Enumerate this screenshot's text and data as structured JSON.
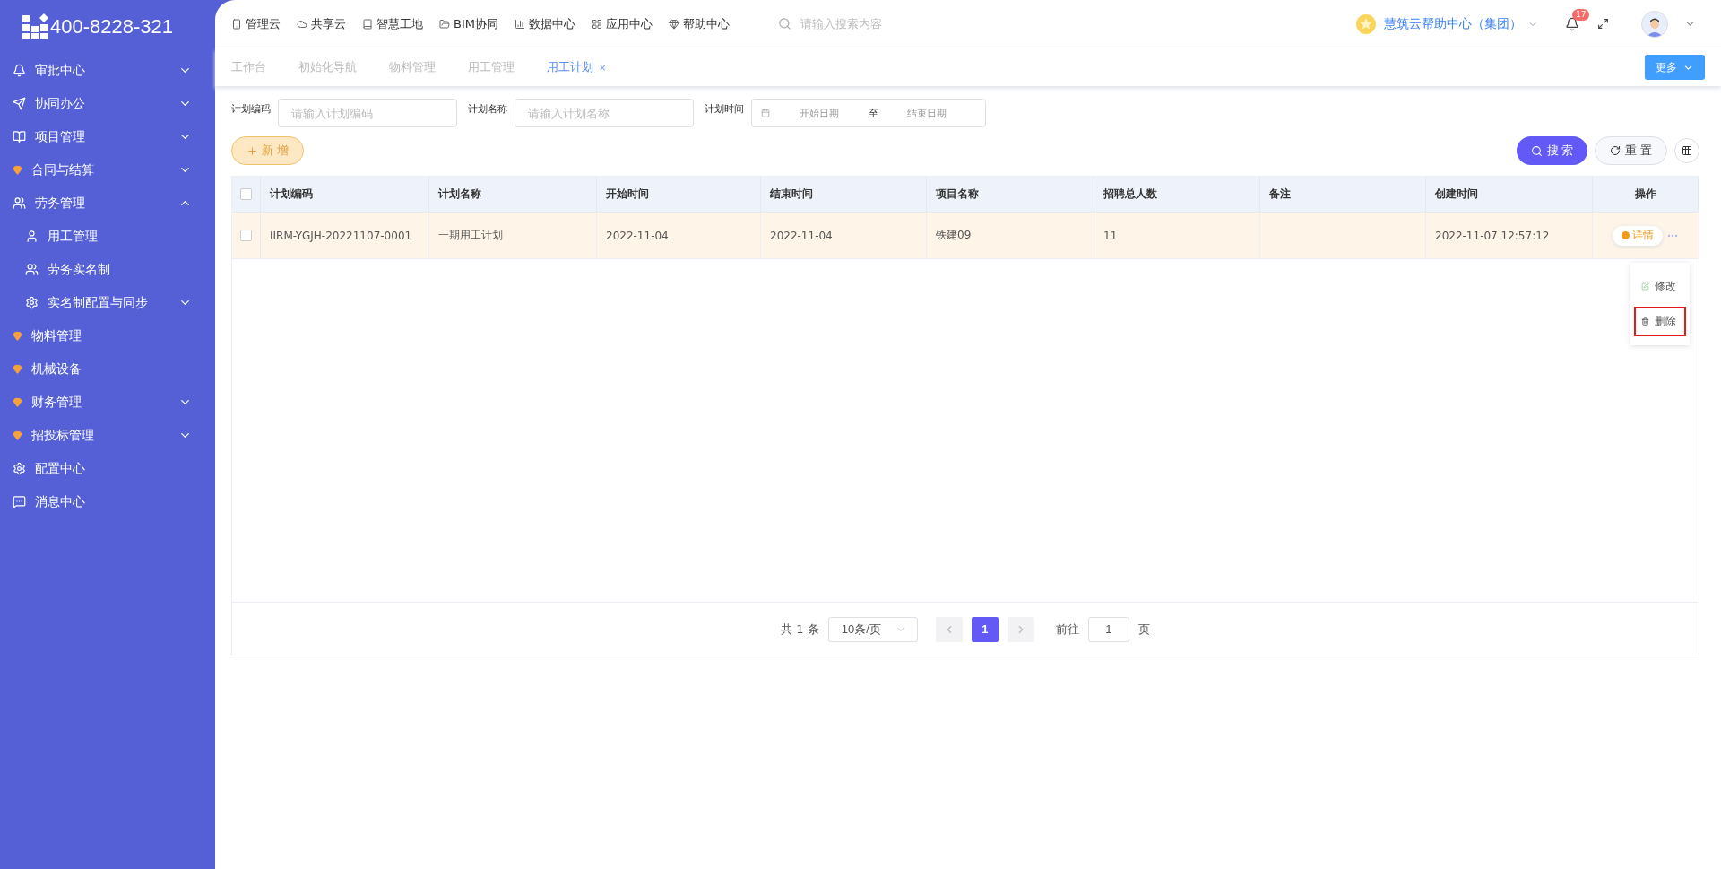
{
  "logo": {
    "phone": "400-8228-321"
  },
  "sidebar": {
    "items": [
      {
        "kind": "group",
        "label": "审批中心",
        "expanded": false
      },
      {
        "kind": "group",
        "label": "协同办公",
        "expanded": false
      },
      {
        "kind": "group",
        "label": "项目管理",
        "expanded": false
      },
      {
        "kind": "group",
        "label": "合同与结算",
        "expanded": false
      },
      {
        "kind": "group",
        "label": "劳务管理",
        "expanded": true,
        "children": [
          {
            "kind": "link",
            "label": "用工管理"
          },
          {
            "kind": "link",
            "label": "劳务实名制"
          },
          {
            "kind": "group",
            "label": "实名制配置与同步",
            "expanded": false
          }
        ]
      },
      {
        "kind": "link",
        "label": "物料管理"
      },
      {
        "kind": "link",
        "label": "机械设备"
      },
      {
        "kind": "group",
        "label": "财务管理",
        "expanded": false
      },
      {
        "kind": "group",
        "label": "招投标管理",
        "expanded": false
      },
      {
        "kind": "link",
        "label": "配置中心"
      },
      {
        "kind": "link",
        "label": "消息中心"
      }
    ]
  },
  "top_nav": {
    "items": [
      {
        "label": "管理云"
      },
      {
        "label": "共享云"
      },
      {
        "label": "智慧工地"
      },
      {
        "label": "BIM协同"
      },
      {
        "label": "数据中心"
      },
      {
        "label": "应用中心"
      },
      {
        "label": "帮助中心"
      }
    ],
    "search_placeholder": "请输入搜索内容",
    "organization": "慧筑云帮助中心（集团）",
    "notification_count": "17"
  },
  "tabs": [
    {
      "label": "工作台",
      "selected": false
    },
    {
      "label": "初始化导航",
      "selected": false
    },
    {
      "label": "物料管理",
      "selected": false
    },
    {
      "label": "用工管理",
      "selected": false
    },
    {
      "label": "用工计划",
      "selected": true,
      "close": "×"
    }
  ],
  "more_button": "更多",
  "filters": [
    {
      "label": "计划编码",
      "placeholder": "请输入计划编码"
    },
    {
      "label": "计划名称",
      "placeholder": "请输入计划名称"
    }
  ],
  "date_filter": {
    "label": "计划时间",
    "start_placeholder": "开始日期",
    "separator": "至",
    "end_placeholder": "结束日期"
  },
  "add_button": "新 增",
  "search_button": "搜 索",
  "reset_button": "重 置",
  "table": {
    "header_checked": false,
    "columns": [
      "计划编码",
      "计划名称",
      "开始时间",
      "结束时间",
      "项目名称",
      "招聘总人数",
      "备注",
      "创建时间",
      "操作"
    ],
    "rows": [
      {
        "selected": true,
        "checked": false,
        "cells": [
          "IIRM-YGJH-20221107-0001",
          "一期用工计划",
          "2022-11-04",
          "2022-11-04",
          "铁建09",
          "11",
          "",
          "2022-11-07 12:57:12"
        ],
        "action": "详情"
      }
    ]
  },
  "row_menu": {
    "items": [
      {
        "label": "修改",
        "highlighted": false
      },
      {
        "label": "删除",
        "highlighted": true
      }
    ]
  },
  "pagination": {
    "total": "共 1 条",
    "page_size": "10条/页",
    "pages": [
      {
        "label": "1",
        "selected": true
      }
    ],
    "goto_label": "前往",
    "goto_value": "1",
    "page_unit": "页"
  }
}
